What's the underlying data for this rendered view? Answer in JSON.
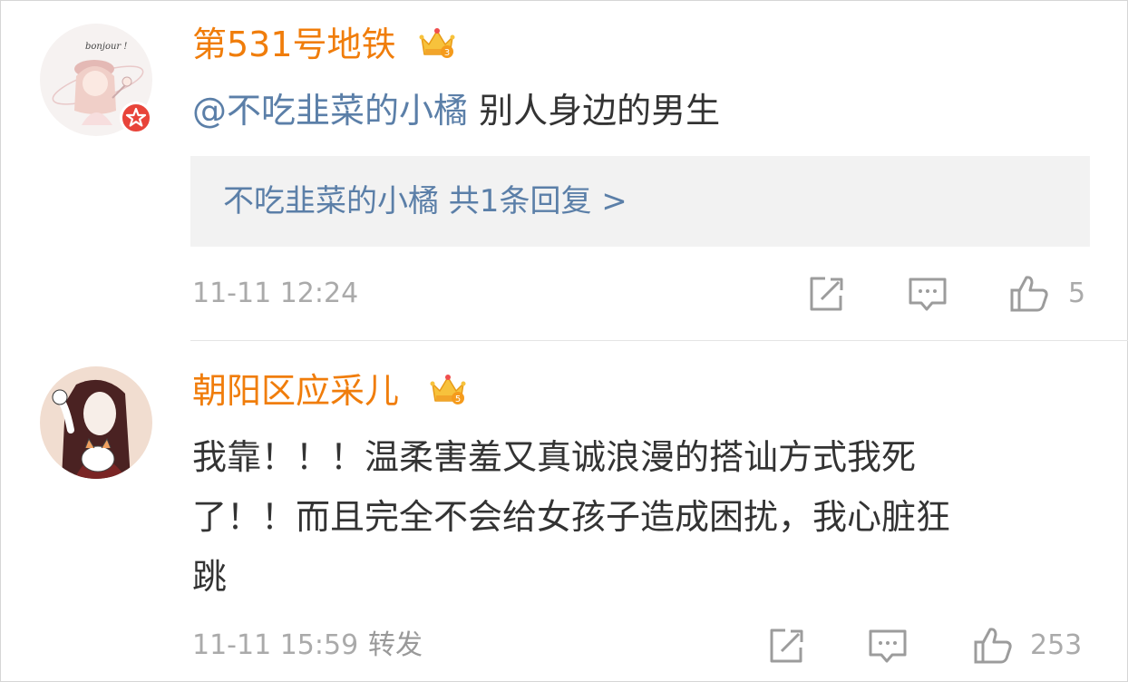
{
  "comments": [
    {
      "username": "第531号地铁",
      "mention": "@不吃韭菜的小橘",
      "text": " 别人身边的男生",
      "reply_summary": "不吃韭菜的小橘  共1条回复 >",
      "timestamp": "11-11 12:24",
      "like_count": "5",
      "avatar_caption": "bonjour !",
      "crown_level": "3"
    },
    {
      "username": "朝阳区应采儿",
      "text_lines": [
        "我靠！！！温柔害羞又真诚浪漫的搭讪方式我死",
        "了！！而且完全不会给女孩子造成困扰，我心脏狂",
        "跳"
      ],
      "timestamp": "11-11 15:59",
      "forward_label": "转发",
      "like_count": "253",
      "crown_level": "5"
    }
  ],
  "colors": {
    "username": "#f07d0b",
    "mention": "#5b7fa8",
    "body_text": "#333333",
    "meta_text": "#aaaaaa",
    "reply_bg": "#f2f2f2",
    "badge_red": "#e8443a"
  },
  "icons": [
    "crown-icon",
    "verified-star-icon",
    "edit-icon",
    "comment-icon",
    "like-icon"
  ]
}
